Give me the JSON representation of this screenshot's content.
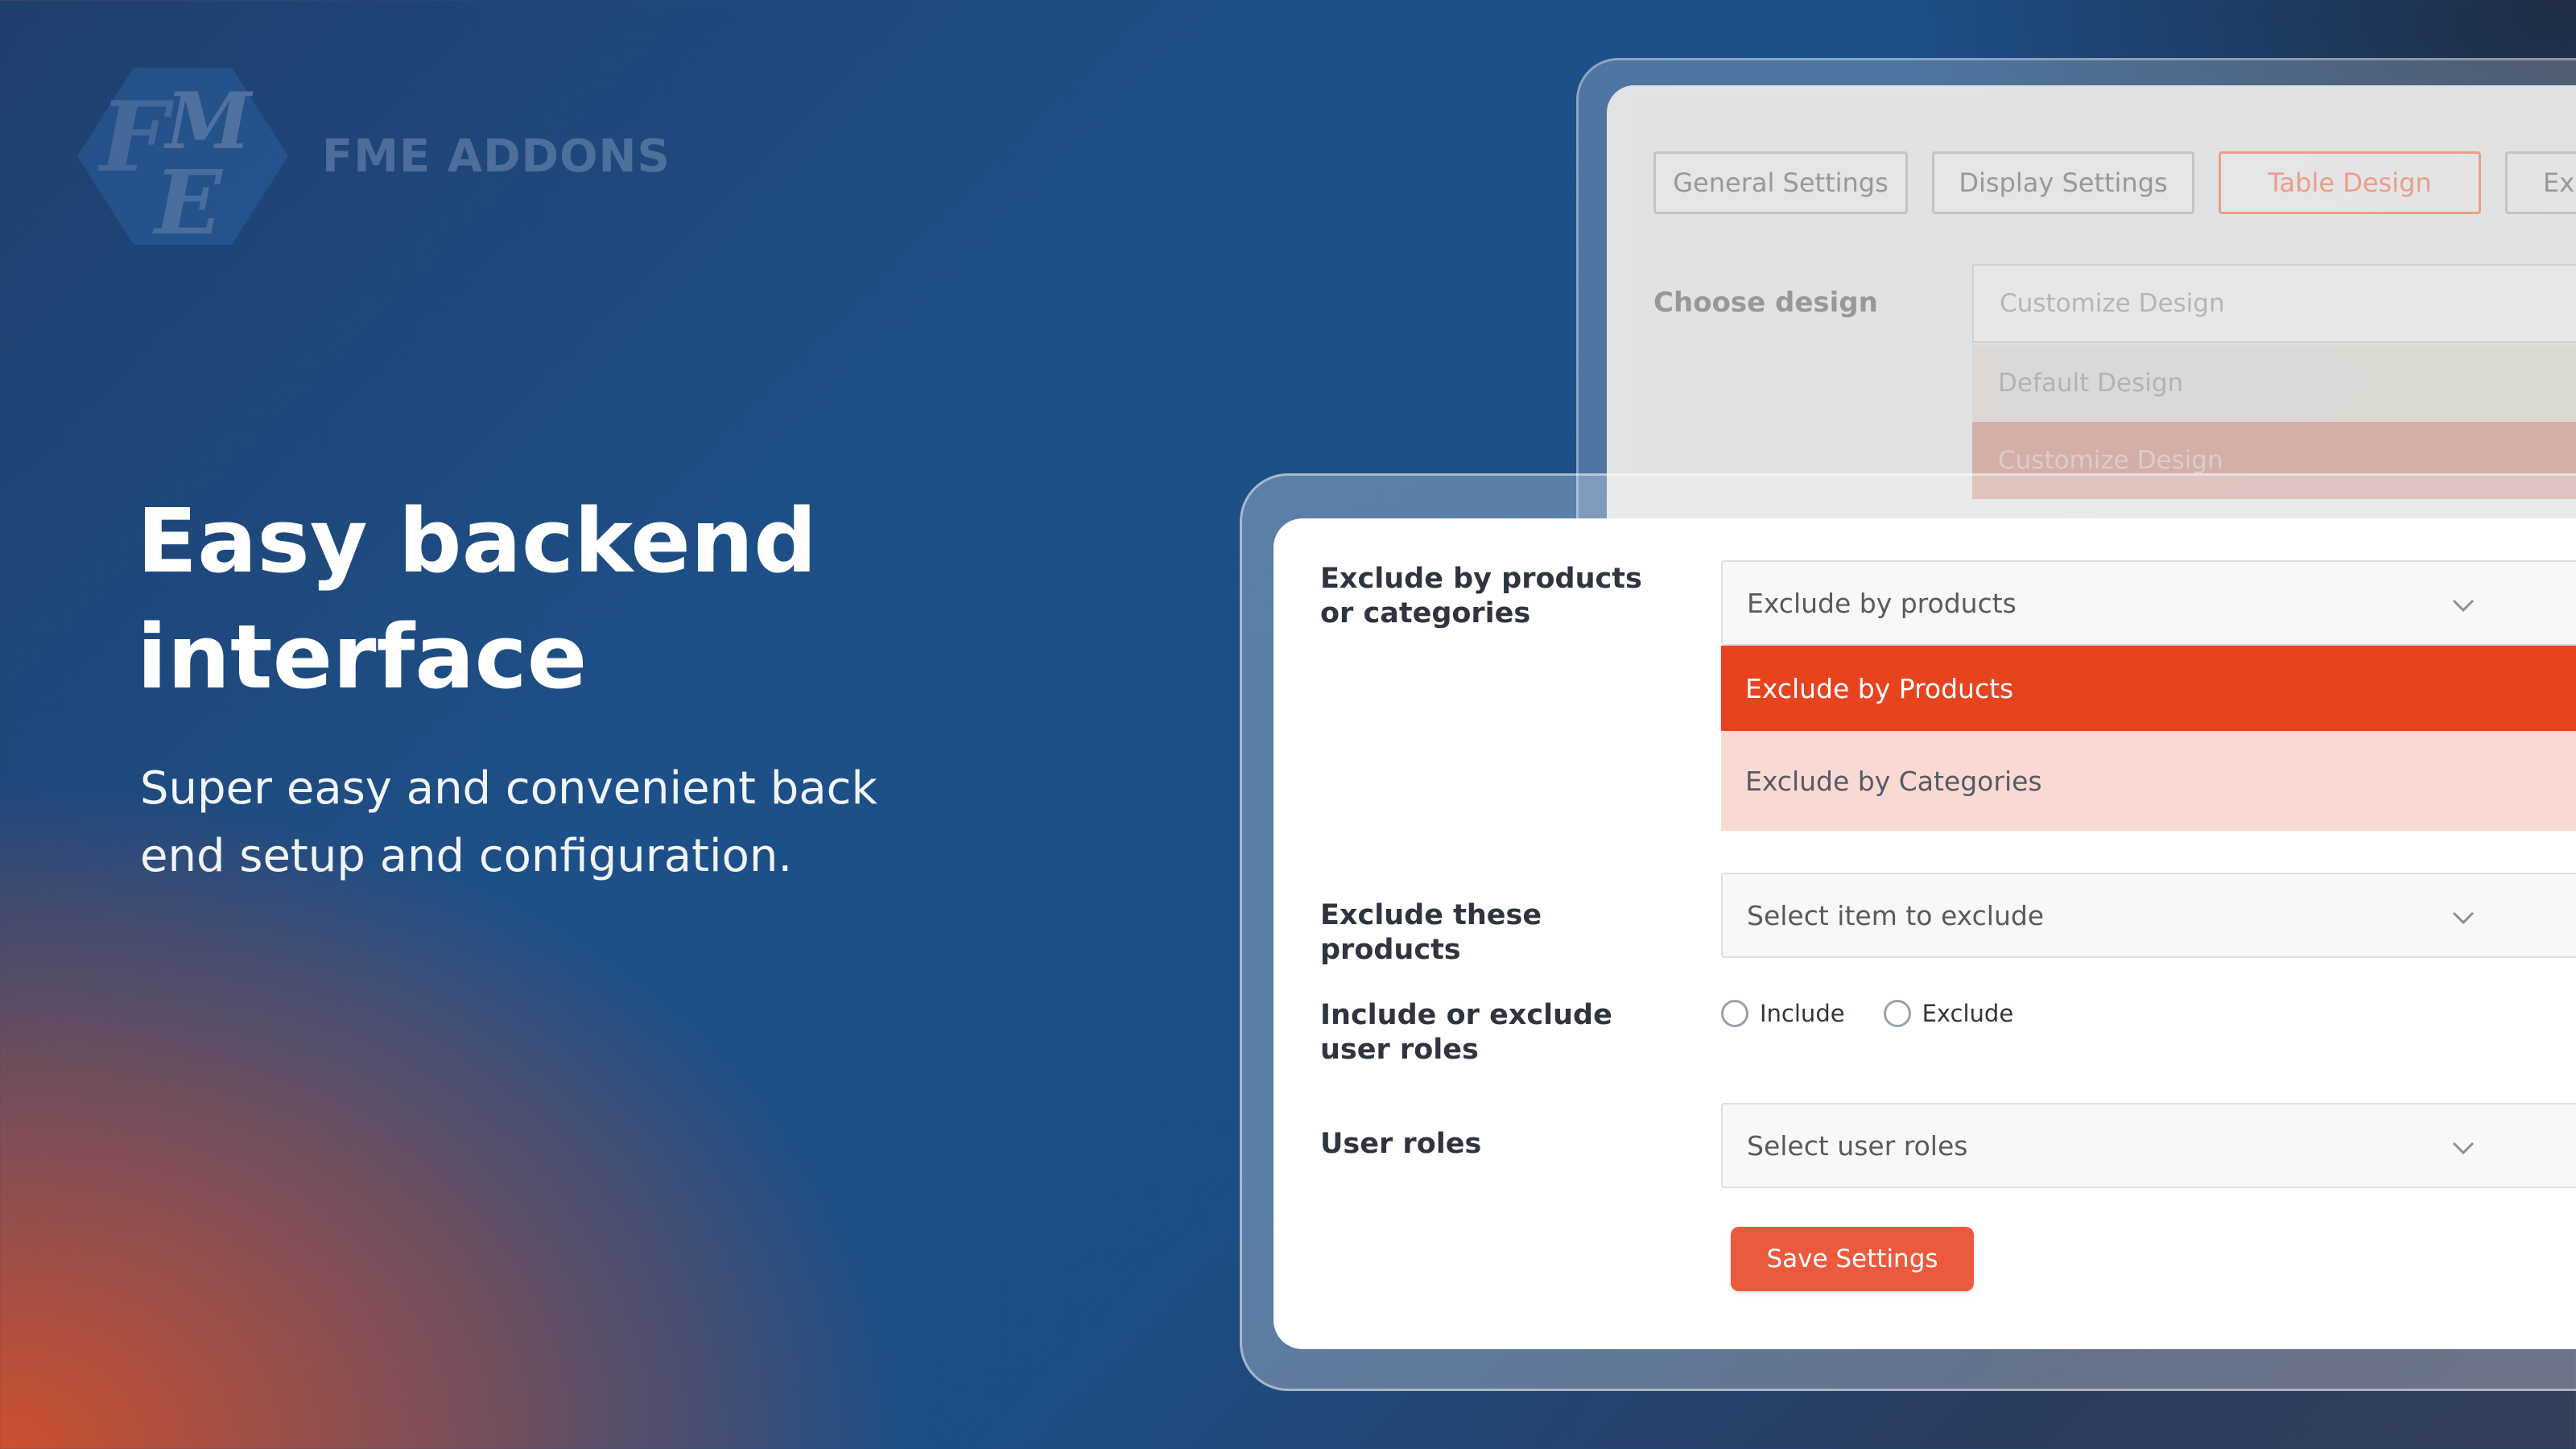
{
  "brand": {
    "name": "FME ADDONS"
  },
  "hero": {
    "title_line1": "Easy backend",
    "title_line2": "interface",
    "subtitle_line1": "Super easy and convenient back",
    "subtitle_line2": "end setup and configuration."
  },
  "back_window": {
    "tabs": [
      {
        "label": "General Settings",
        "active": false
      },
      {
        "label": "Display Settings",
        "active": false
      },
      {
        "label": "Table Design",
        "active": true
      },
      {
        "label": "Ex",
        "active": false
      }
    ],
    "choose_design_label": "Choose design",
    "select_value": "Customize Design",
    "options": [
      "Default Design",
      "Customize Design"
    ]
  },
  "front_window": {
    "exclude_by_label": "Exclude by products or categories",
    "exclude_by_value": "Exclude by products",
    "exclude_by_options": [
      "Exclude by Products",
      "Exclude by Categories"
    ],
    "exclude_products_label": "Exclude these products",
    "exclude_products_placeholder": "Select item to exclude",
    "roles_toggle_label": "Include or exclude user roles",
    "roles_toggle_options": [
      "Include",
      "Exclude"
    ],
    "user_roles_label": "User roles",
    "user_roles_placeholder": "Select user roles",
    "save_label": "Save Settings"
  },
  "colors": {
    "accent": "#e8431f",
    "button": "#ec5a3e",
    "option_highlight": "#fbd9d3"
  }
}
